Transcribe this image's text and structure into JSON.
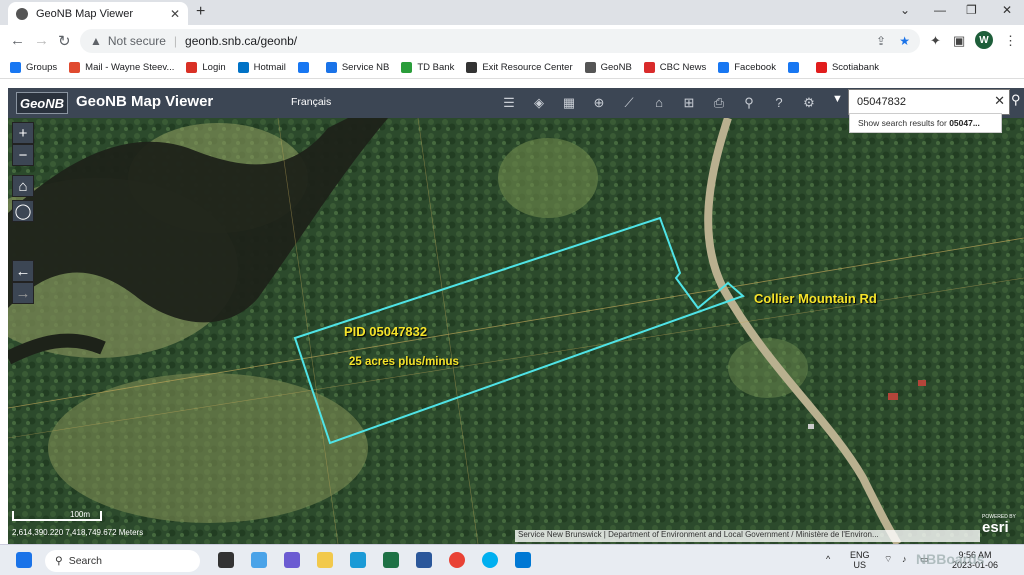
{
  "browser": {
    "tab_title": "GeoNB Map Viewer",
    "url_security": "Not secure",
    "url": "geonb.snb.ca/geonb/",
    "profile_initial": "W",
    "bookmarks": [
      {
        "label": "Groups",
        "color": "#1877f2"
      },
      {
        "label": "Mail - Wayne Steev...",
        "color": "#e04a2f"
      },
      {
        "label": "Login",
        "color": "#d93025"
      },
      {
        "label": "Hotmail",
        "color": "#0072c6"
      },
      {
        "label": "",
        "color": "#1877f2"
      },
      {
        "label": "Service NB",
        "color": "#1a73e8"
      },
      {
        "label": "TD Bank",
        "color": "#2a9d3a"
      },
      {
        "label": "Exit Resource Center",
        "color": "#333333"
      },
      {
        "label": "GeoNB",
        "color": "#555555"
      },
      {
        "label": "CBC News",
        "color": "#d92b2b"
      },
      {
        "label": "Facebook",
        "color": "#1877f2"
      },
      {
        "label": "",
        "color": "#1877f2"
      },
      {
        "label": "Scotiabank",
        "color": "#e11d1d"
      }
    ]
  },
  "app": {
    "logo": "GeoNB",
    "title": "GeoNB Map Viewer",
    "language": "Français",
    "search_value": "05047832",
    "suggestion_prefix": "Show search results for ",
    "suggestion_term": "05047..."
  },
  "map": {
    "parcel_label": "PID 05047832",
    "area_label": "25 acres plus/minus",
    "road_label": "Collier Mountain Rd",
    "scale_label": "100m",
    "coordinates": "2,614,390.220 7,418,749.672 Meters",
    "attribution": "Service New Brunswick | Department of Environment and Local Government / Ministère de l'Environ...",
    "esri_powered": "POWERED BY",
    "esri": "esri",
    "parcel_color": "#4fe3e6",
    "label_color": "#f5e32a"
  },
  "taskbar": {
    "search_placeholder": "Search",
    "lang_top": "ENG",
    "lang_bottom": "US",
    "time": "9:56 AM",
    "date": "2023-01-06"
  },
  "watermark": "NBBoards"
}
